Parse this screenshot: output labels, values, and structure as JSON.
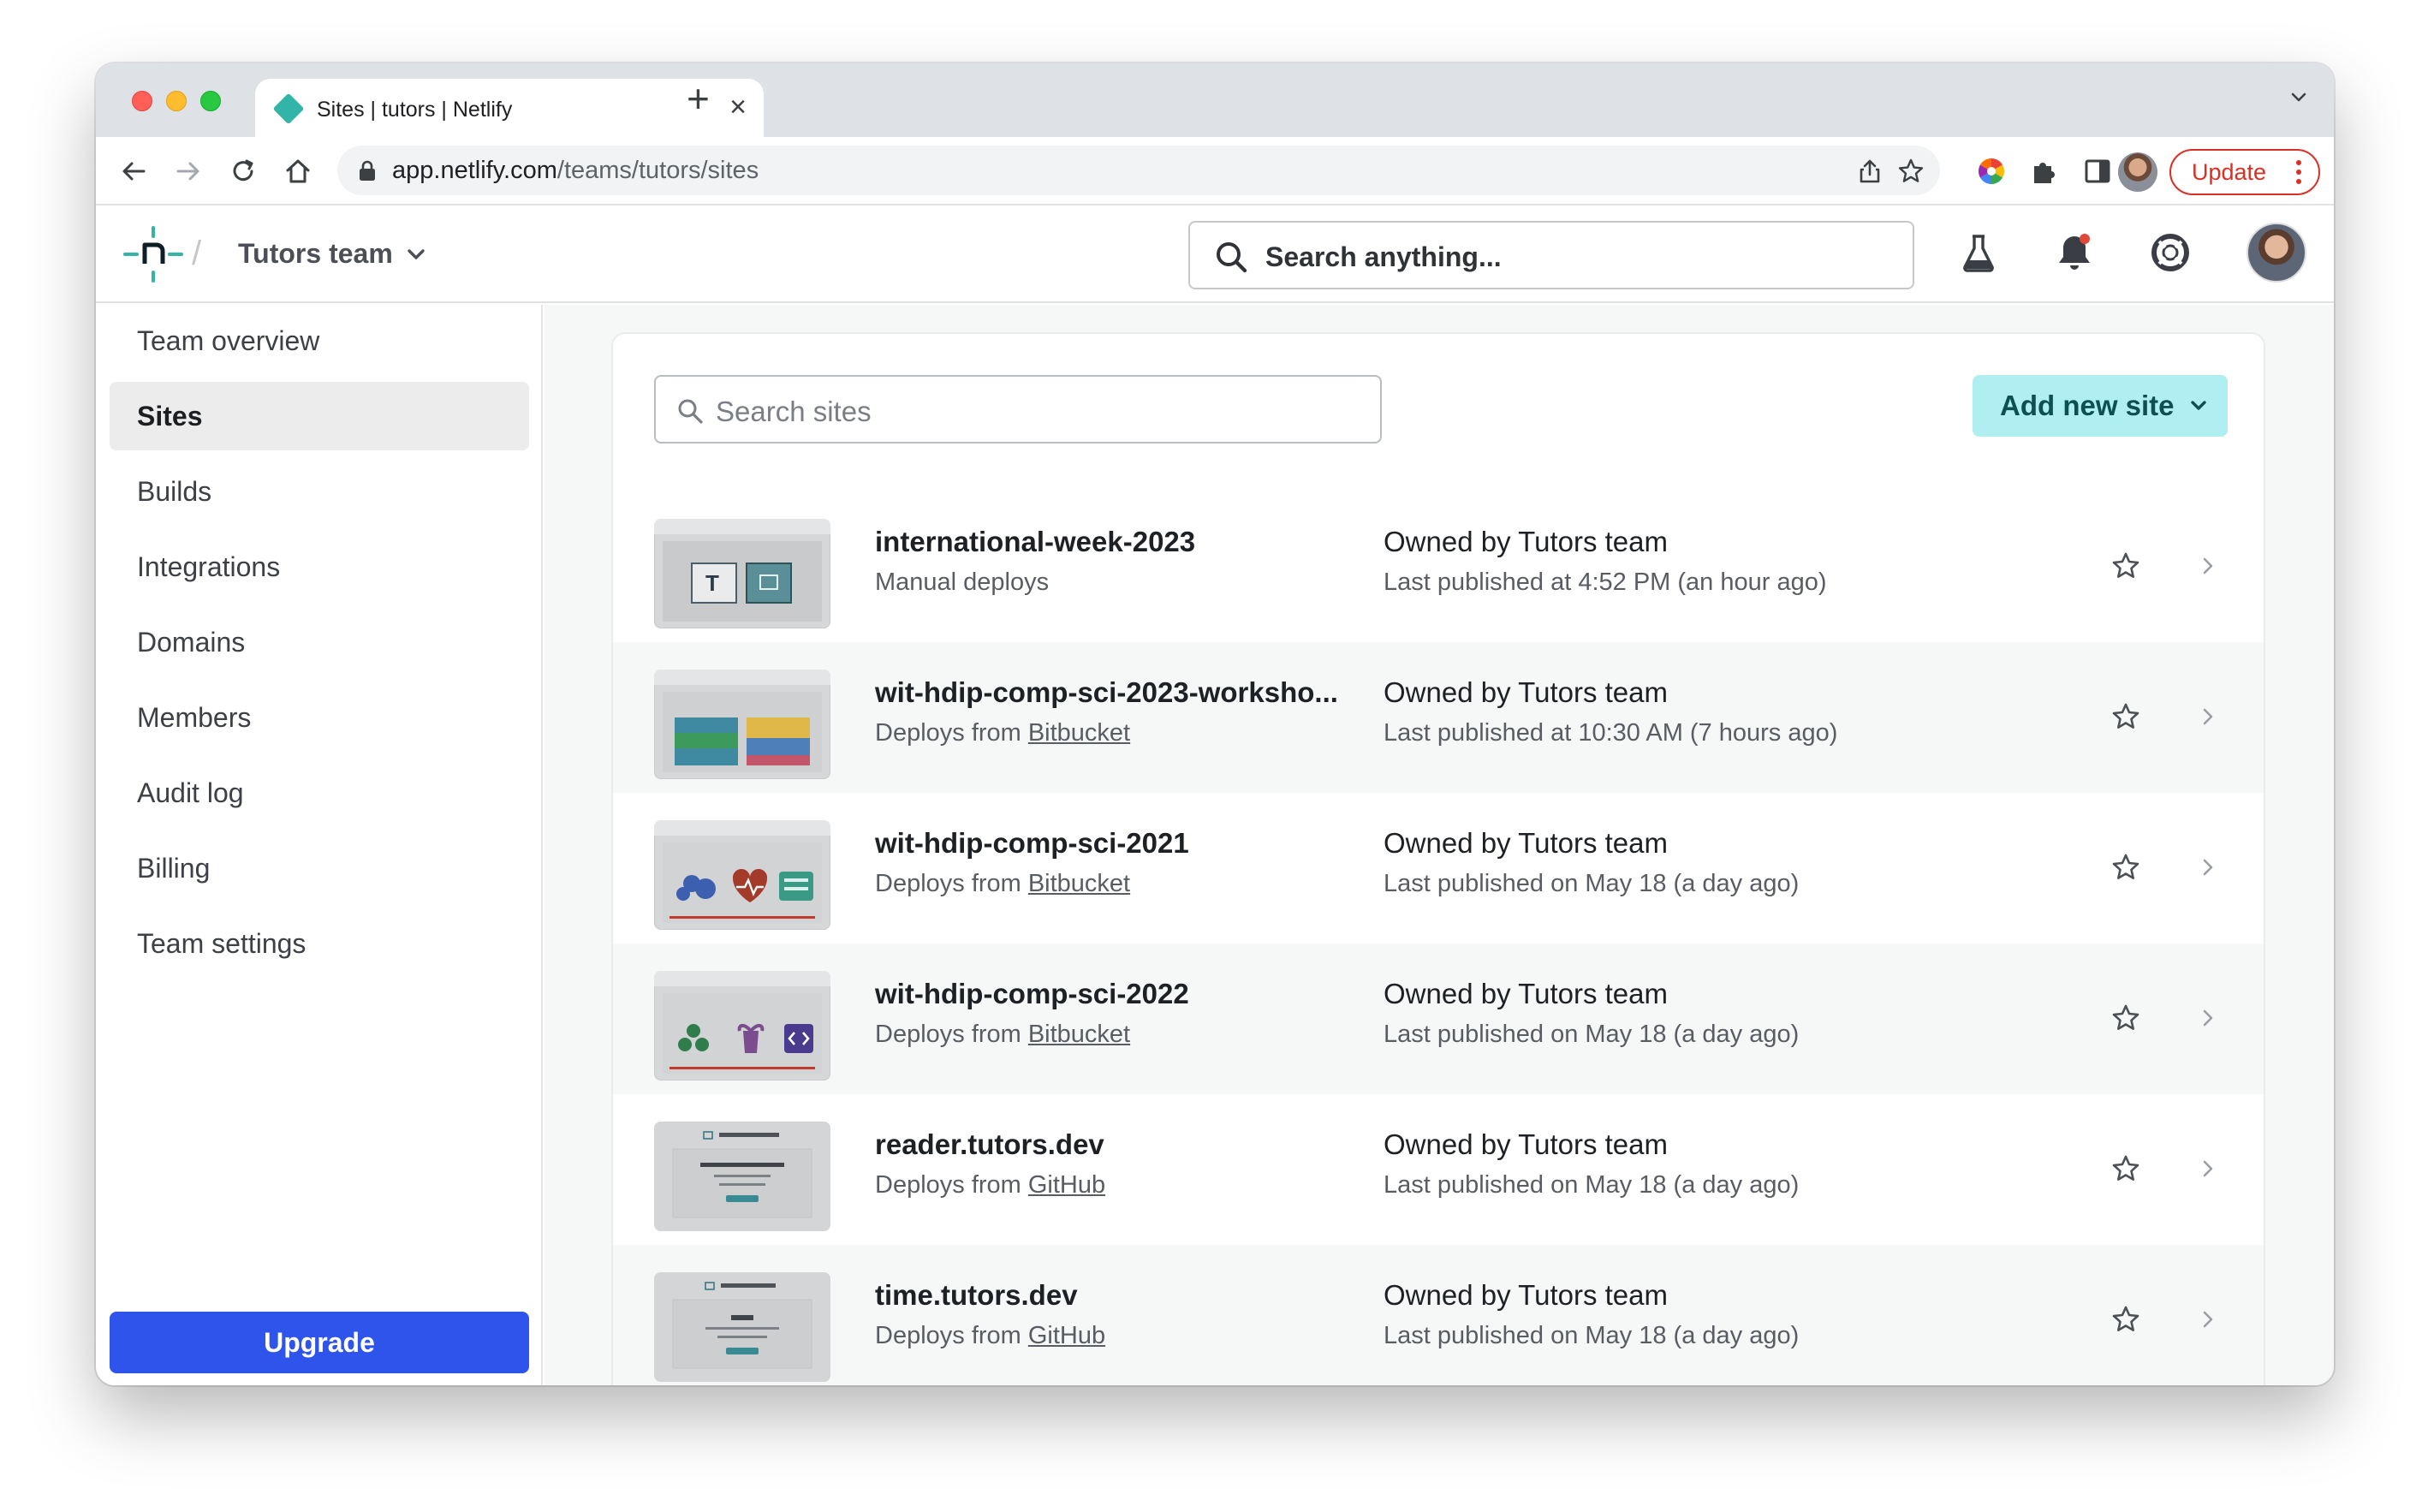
{
  "browser": {
    "tab_title": "Sites | tutors | Netlify",
    "new_tab": "+",
    "close": "×",
    "url_host": "app.netlify.com",
    "url_path": "/teams/tutors/sites",
    "update_label": "Update"
  },
  "header": {
    "separator": "/",
    "team_name": "Tutors team",
    "search_placeholder": "Search anything..."
  },
  "sidebar": {
    "items": [
      {
        "label": "Team overview"
      },
      {
        "label": "Sites"
      },
      {
        "label": "Builds"
      },
      {
        "label": "Integrations"
      },
      {
        "label": "Domains"
      },
      {
        "label": "Members"
      },
      {
        "label": "Audit log"
      },
      {
        "label": "Billing"
      },
      {
        "label": "Team settings"
      }
    ],
    "active_index": 1,
    "upgrade_label": "Upgrade"
  },
  "main": {
    "search_placeholder": "Search sites",
    "add_site_label": "Add new site",
    "sites": [
      {
        "name": "international-week-2023",
        "deploy_prefix": "Manual deploys",
        "deploy_source": "",
        "owner_prefix": "Owned by",
        "owner": "Tutors team",
        "published": "Last published at 4:52 PM (an hour ago)"
      },
      {
        "name": "wit-hdip-comp-sci-2023-worksho...",
        "deploy_prefix": "Deploys from",
        "deploy_source": "Bitbucket",
        "owner_prefix": "Owned by",
        "owner": "Tutors team",
        "published": "Last published at 10:30 AM (7 hours ago)"
      },
      {
        "name": "wit-hdip-comp-sci-2021",
        "deploy_prefix": "Deploys from",
        "deploy_source": "Bitbucket",
        "owner_prefix": "Owned by",
        "owner": "Tutors team",
        "published": "Last published on May 18 (a day ago)"
      },
      {
        "name": "wit-hdip-comp-sci-2022",
        "deploy_prefix": "Deploys from",
        "deploy_source": "Bitbucket",
        "owner_prefix": "Owned by",
        "owner": "Tutors team",
        "published": "Last published on May 18 (a day ago)"
      },
      {
        "name": "reader.tutors.dev",
        "deploy_prefix": "Deploys from",
        "deploy_source": "GitHub",
        "owner_prefix": "Owned by",
        "owner": "Tutors team",
        "published": "Last published on May 18 (a day ago)"
      },
      {
        "name": "time.tutors.dev",
        "deploy_prefix": "Deploys from",
        "deploy_source": "GitHub",
        "owner_prefix": "Owned by",
        "owner": "Tutors team",
        "published": "Last published on May 18 (a day ago)"
      }
    ]
  },
  "icons": {
    "browser": [
      "back-icon",
      "forward-icon",
      "reload-icon",
      "home-icon",
      "lock-icon",
      "share-icon",
      "bookmark-star-icon",
      "color-wheel-extension-icon",
      "puzzle-extensions-icon",
      "side-panel-icon",
      "profile-avatar",
      "more-vert-icon",
      "tab-list-chevron-icon"
    ],
    "app": [
      "netlify-logo-icon",
      "search-icon",
      "labs-flask-icon",
      "bell-notification-icon",
      "help-lifebuoy-icon",
      "user-avatar",
      "favorite-star-icon",
      "row-chevron-right-icon"
    ]
  },
  "colors": {
    "accent_teal": "#32b5a8",
    "add_site_bg": "#afeff1",
    "upgrade_bg": "#2f54eb",
    "update_red": "#d93025",
    "notification_dot": "#e0463a"
  }
}
